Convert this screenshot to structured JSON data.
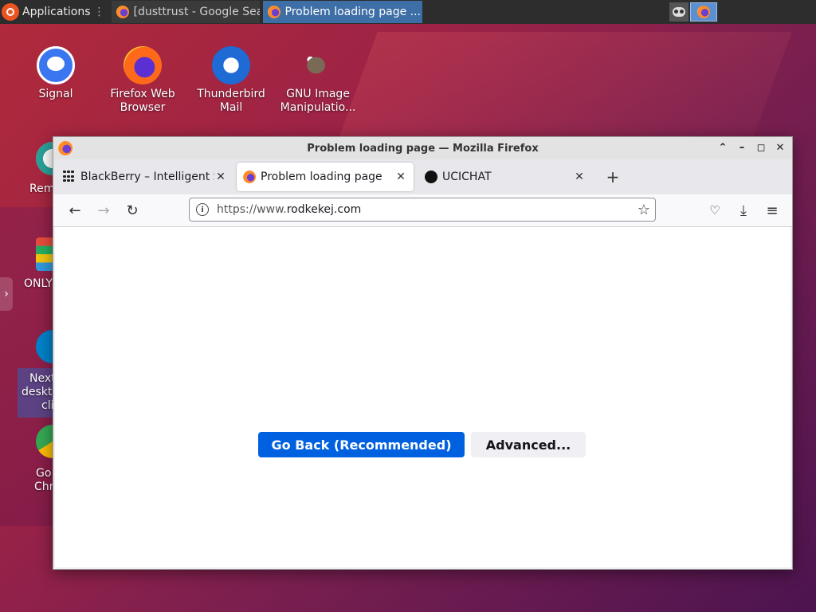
{
  "panel": {
    "apps_label": "Applications",
    "tasks": [
      {
        "label": "[dusttrust - Google Sear..."
      },
      {
        "label": "Problem loading page ..."
      }
    ]
  },
  "desktop": {
    "icons": [
      {
        "label": "Signal"
      },
      {
        "label": "Firefox Web Browser"
      },
      {
        "label": "Thunderbird Mail"
      },
      {
        "label": "GNU Image Manipulatio..."
      }
    ],
    "side": {
      "remmina": "Rem",
      "onlyoffice": "ONLY",
      "nextcloud1": "Next",
      "nextcloud2": "deskto",
      "nextcloud3": "cli",
      "chrome1": "Go",
      "chrome2": "Chr"
    }
  },
  "window": {
    "title": "Problem loading page — Mozilla Firefox",
    "tabs": [
      {
        "label": "BlackBerry – Intelligent S"
      },
      {
        "label": "Problem loading page"
      },
      {
        "label": "UCICHAT"
      }
    ],
    "url": {
      "prefix": "https://www.",
      "domain": "rodkekej.com"
    }
  },
  "error_page": {
    "go_back": "Go Back (Recommended)",
    "advanced": "Advanced..."
  },
  "colors": {
    "primary_button": "#0061e0",
    "active_task": "#3d6ea5",
    "panel": "#2d2d2d"
  }
}
